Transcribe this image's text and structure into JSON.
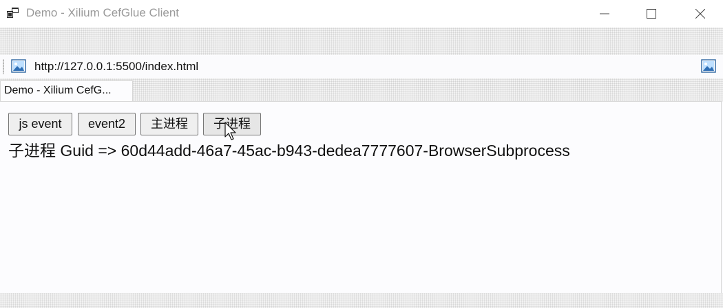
{
  "window": {
    "title": "Demo - Xilium CefGlue Client",
    "icons": {
      "app": "app-window-icon",
      "minimize": "minimize-icon",
      "maximize": "maximize-icon",
      "close": "close-icon"
    }
  },
  "address_bar": {
    "url": "http://127.0.0.1:5500/index.html",
    "left_icon": "image-icon",
    "right_icon": "image-icon"
  },
  "tabs": [
    {
      "label": "Demo - Xilium CefG...",
      "active": true
    }
  ],
  "page": {
    "buttons": [
      {
        "label": "js event"
      },
      {
        "label": "event2"
      },
      {
        "label": "主进程"
      },
      {
        "label": "子进程"
      }
    ],
    "result_text": "子进程 Guid => 60d44add-46a7-45ac-b943-dedea7777607-BrowserSubprocess",
    "cursor": "arrow-cursor-icon"
  },
  "colors": {
    "title_text": "#9a9a9a",
    "content_bg": "#fcfcfe",
    "button_bg": "#efefef",
    "button_border": "#767676"
  }
}
